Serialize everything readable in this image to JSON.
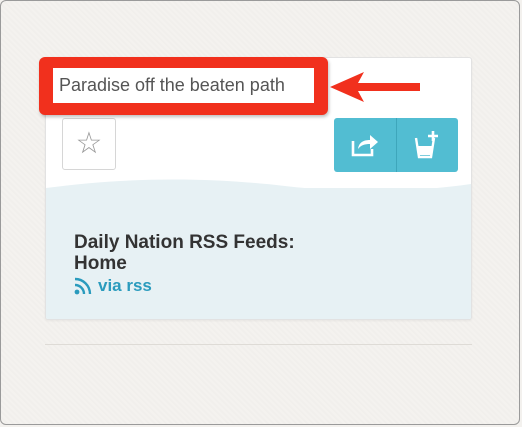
{
  "annotation": {
    "callout_text": "Paradise off the beaten path",
    "callout_color": "#f1301d"
  },
  "card": {
    "star_icon": "☆",
    "actions": [
      {
        "name": "share-icon"
      },
      {
        "name": "add-to-list-icon"
      }
    ],
    "source_title": "Daily Nation RSS Feeds: Home",
    "via_label": "via rss",
    "accent_color": "#52bdd2",
    "link_color": "#2a9bbd"
  }
}
